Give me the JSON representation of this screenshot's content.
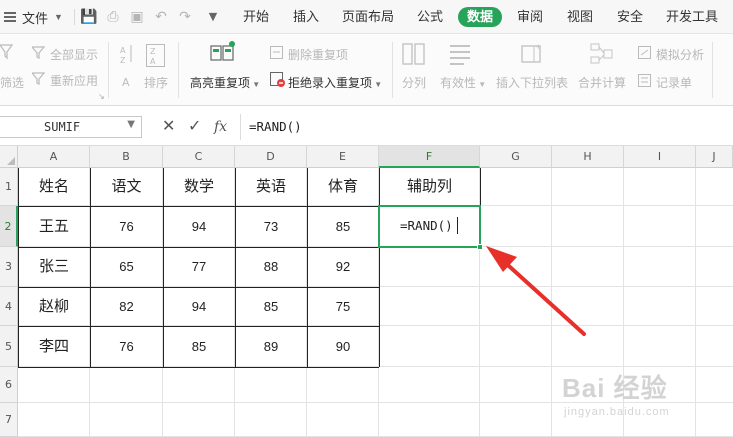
{
  "menubar": {
    "file_label": "文件",
    "tabs": [
      {
        "label": "开始",
        "active": false
      },
      {
        "label": "插入",
        "active": false
      },
      {
        "label": "页面布局",
        "active": false
      },
      {
        "label": "公式",
        "active": false
      },
      {
        "label": "数据",
        "active": true
      },
      {
        "label": "审阅",
        "active": false
      },
      {
        "label": "视图",
        "active": false
      },
      {
        "label": "安全",
        "active": false
      },
      {
        "label": "开发工具",
        "active": false
      }
    ],
    "accent_color": "#27a35a"
  },
  "ribbon": {
    "show_all": "全部显示",
    "filter": "筛选",
    "reapply": "重新应用",
    "sort": "排序",
    "highlight_duplicates": "高亮重复项",
    "delete_duplicates": "删除重复项",
    "reject_duplicates": "拒绝录入重复项",
    "split_column": "分列",
    "validity": "有效性",
    "insert_dropdown": "插入下拉列表",
    "consolidate": "合并计算",
    "what_if": "模拟分析",
    "record_list": "记录单"
  },
  "formula_bar": {
    "name_box": "SUMIF",
    "fx": "fx",
    "formula": "=RAND()"
  },
  "sheet": {
    "columns": [
      "A",
      "B",
      "C",
      "D",
      "E",
      "F",
      "G",
      "H",
      "I",
      "J"
    ],
    "rows": [
      "1",
      "2",
      "3",
      "4",
      "5",
      "6",
      "7"
    ],
    "selected_column": "F",
    "selected_row": "2",
    "headers": [
      "姓名",
      "语文",
      "数学",
      "英语",
      "体育",
      "辅助列"
    ],
    "data": [
      [
        "王五",
        "76",
        "94",
        "73",
        "85"
      ],
      [
        "张三",
        "65",
        "77",
        "88",
        "92"
      ],
      [
        "赵柳",
        "82",
        "94",
        "85",
        "75"
      ],
      [
        "李四",
        "76",
        "85",
        "89",
        "90"
      ]
    ],
    "active_cell_text": "=RAND()"
  },
  "watermark": {
    "main": "Bai 经验",
    "sub": "jingyan.baidu.com"
  }
}
